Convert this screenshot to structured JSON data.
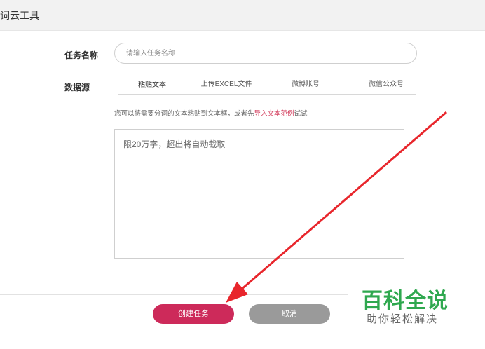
{
  "window": {
    "title": "词云工具"
  },
  "form": {
    "task_name_label": "任务名称",
    "task_name_placeholder": "请输入任务名称",
    "task_name_value": "",
    "source_label": "数据源",
    "tabs": [
      {
        "label": "粘贴文本",
        "active": true
      },
      {
        "label": "上传EXCEL文件",
        "active": false
      },
      {
        "label": "微博账号",
        "active": false
      },
      {
        "label": "微信公众号",
        "active": false
      }
    ],
    "hint_prefix": "您可以将需要分词的文本粘贴到文本框，或者先",
    "hint_link": "导入文本范例",
    "hint_suffix": "试试",
    "content_placeholder": "限20万字，超出将自动截取",
    "content_value": ""
  },
  "actions": {
    "create_label": "创建任务",
    "cancel_label": "取消"
  },
  "watermark": {
    "main": "百科全说",
    "sub": "助你轻松解决"
  },
  "colors": {
    "accent": "#cd2a5a",
    "cancel": "#9a9a9a",
    "annotation_arrow": "#e8262c",
    "watermark_green": "#2fa84f"
  }
}
